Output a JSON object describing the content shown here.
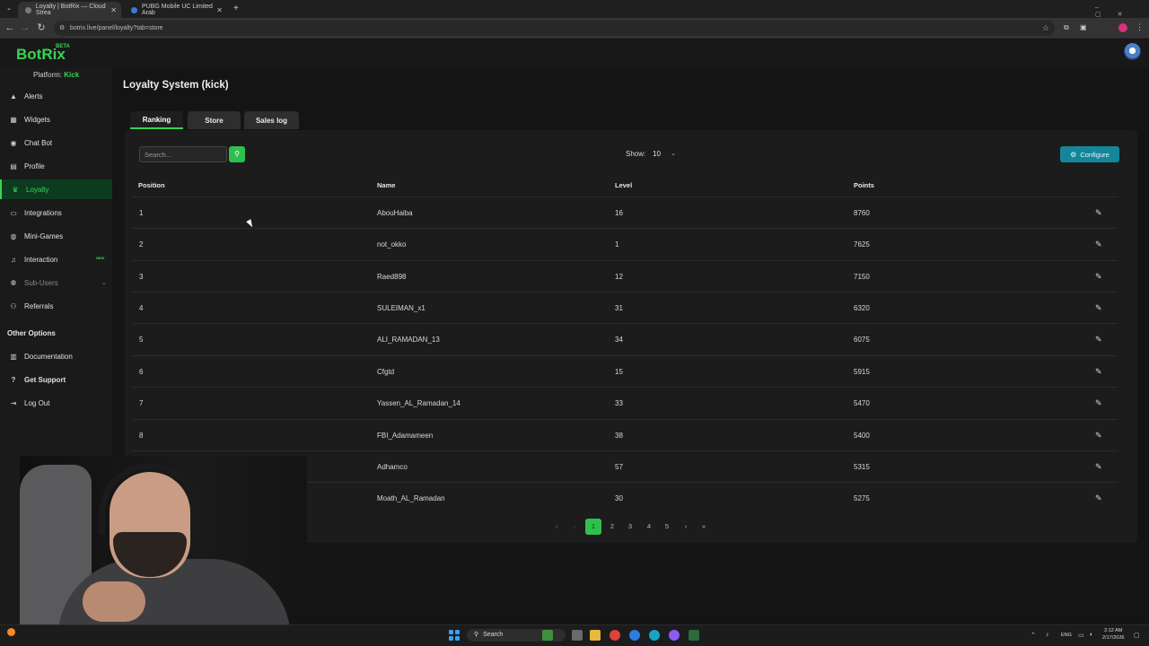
{
  "browser": {
    "tabs": [
      {
        "title": "Loyalty | BotRix — Cloud Strea",
        "active": true
      },
      {
        "title": "PUBG Mobile UC Limited Arab",
        "active": false
      }
    ],
    "url": "botrix.live/panel/loyalty?tab=store"
  },
  "app": {
    "logo": "BotRix",
    "beta": "BETA",
    "platform_label": "Platform:",
    "platform_value": "Kick"
  },
  "sidebar": {
    "items": [
      {
        "label": "Alerts",
        "icon": "warning-icon"
      },
      {
        "label": "Widgets",
        "icon": "widgets-icon"
      },
      {
        "label": "Chat Bot",
        "icon": "chatbot-icon"
      },
      {
        "label": "Profile",
        "icon": "profile-icon"
      },
      {
        "label": "Loyalty",
        "icon": "trophy-icon"
      },
      {
        "label": "Integrations",
        "icon": "integrations-icon"
      },
      {
        "label": "Mini-Games",
        "icon": "gamepad-icon"
      },
      {
        "label": "Interaction",
        "icon": "music-icon",
        "badge": "NEW"
      },
      {
        "label": "Sub-Users",
        "icon": "users-icon"
      },
      {
        "label": "Referrals",
        "icon": "referrals-icon"
      }
    ],
    "other_heading": "Other Options",
    "other_items": [
      {
        "label": "Documentation",
        "icon": "document-icon"
      },
      {
        "label": "Get Support",
        "icon": "help-icon"
      },
      {
        "label": "Log Out",
        "icon": "logout-icon"
      }
    ]
  },
  "page": {
    "title": "Loyalty System (kick)",
    "tabs": [
      "Ranking",
      "Store",
      "Sales log"
    ],
    "search_placeholder": "Search...",
    "show_label": "Show:",
    "show_value": "10",
    "configure_label": "Configure"
  },
  "table": {
    "columns": [
      "Position",
      "Name",
      "Level",
      "Points"
    ],
    "rows": [
      {
        "position": "1",
        "name": "AbouHaiba",
        "level": "16",
        "points": "8760"
      },
      {
        "position": "2",
        "name": "not_okko",
        "level": "1",
        "points": "7625"
      },
      {
        "position": "3",
        "name": "Raed898",
        "level": "12",
        "points": "7150"
      },
      {
        "position": "4",
        "name": "SULEIMAN_x1",
        "level": "31",
        "points": "6320"
      },
      {
        "position": "5",
        "name": "ALI_RAMADAN_13",
        "level": "34",
        "points": "6075"
      },
      {
        "position": "6",
        "name": "Cfgtd",
        "level": "15",
        "points": "5915"
      },
      {
        "position": "7",
        "name": "Yassen_AL_Ramadan_14",
        "level": "33",
        "points": "5470"
      },
      {
        "position": "8",
        "name": "FBI_Adamameen",
        "level": "38",
        "points": "5400"
      },
      {
        "position": "",
        "name": "Adhamco",
        "level": "57",
        "points": "5315"
      },
      {
        "position": "",
        "name": "Moath_AL_Ramadan",
        "level": "30",
        "points": "5275"
      }
    ]
  },
  "pagination": {
    "first": "«",
    "prev": "‹",
    "pages": [
      "1",
      "2",
      "3",
      "4",
      "5"
    ],
    "current": "1",
    "next": "›",
    "last": "»"
  },
  "taskbar": {
    "search": "Search",
    "lang": "ENG",
    "time": "2:12 AM",
    "date": "2/17/2026"
  },
  "colors": {
    "accent": "#39d353",
    "configure": "#15869a"
  }
}
